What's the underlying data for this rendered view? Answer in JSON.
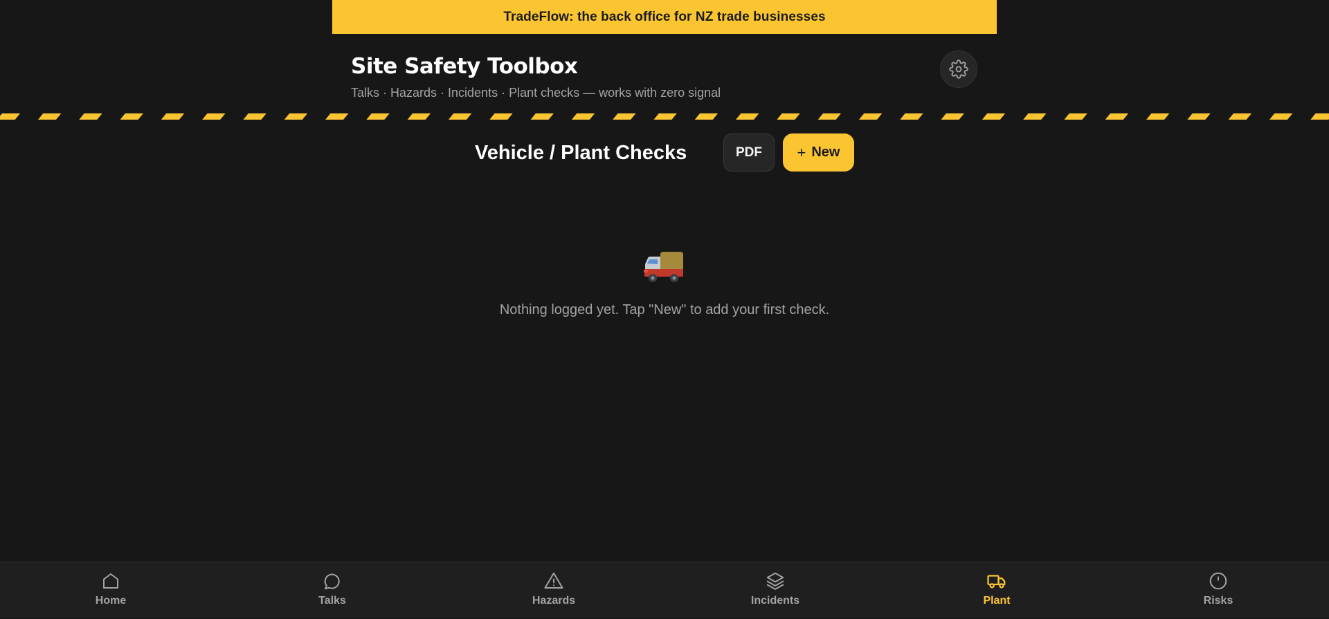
{
  "banner": {
    "text": "TradeFlow: the back office for NZ trade businesses"
  },
  "header": {
    "title": "Site Safety Toolbox",
    "subtitle": "Talks · Hazards · Incidents · Plant checks — works with zero signal",
    "settings_icon": "gear-icon"
  },
  "section": {
    "title": "Vehicle / Plant Checks",
    "pdf_label": "PDF",
    "new_plus": "+",
    "new_label": "New"
  },
  "empty_state": {
    "icon": "truck-icon",
    "text": "Nothing logged yet. Tap \"New\" to add your first check."
  },
  "nav": {
    "active": "Plant",
    "items": [
      {
        "label": "Home",
        "icon": "home-icon"
      },
      {
        "label": "Talks",
        "icon": "chat-bubble-icon"
      },
      {
        "label": "Hazards",
        "icon": "warning-triangle-icon"
      },
      {
        "label": "Incidents",
        "icon": "layers-icon"
      },
      {
        "label": "Plant",
        "icon": "truck-icon"
      },
      {
        "label": "Risks",
        "icon": "alert-circle-icon"
      }
    ]
  },
  "colors": {
    "background": "#171717",
    "accent": "#fbc531",
    "muted_text": "#a3a3a3",
    "nav_background": "#1f1f1f"
  }
}
